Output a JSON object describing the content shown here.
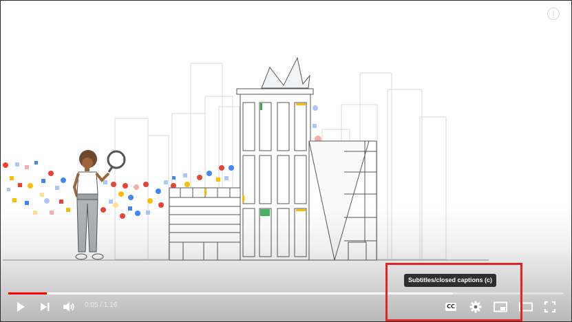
{
  "player": {
    "info_icon": "info-icon",
    "progress": {
      "played_fraction": 0.07,
      "loaded_fraction": 0.8
    },
    "controls": {
      "play_icon": "play-icon",
      "next_icon": "next-icon",
      "volume_icon": "volume-icon",
      "time_current": "0:05",
      "time_separator": " / ",
      "time_total": "1:16",
      "time_text": "0:05 / 1:16",
      "cc_icon": "subtitles-icon",
      "cc_label": "CC",
      "settings_icon": "gear-icon",
      "miniplayer_icon": "miniplayer-icon",
      "theater_icon": "theater-mode-icon",
      "fullscreen_icon": "fullscreen-icon"
    },
    "tooltip": "Subtitles/closed captions (c)",
    "highlight_color": "#e32424",
    "accent_color": "#ff0000"
  }
}
